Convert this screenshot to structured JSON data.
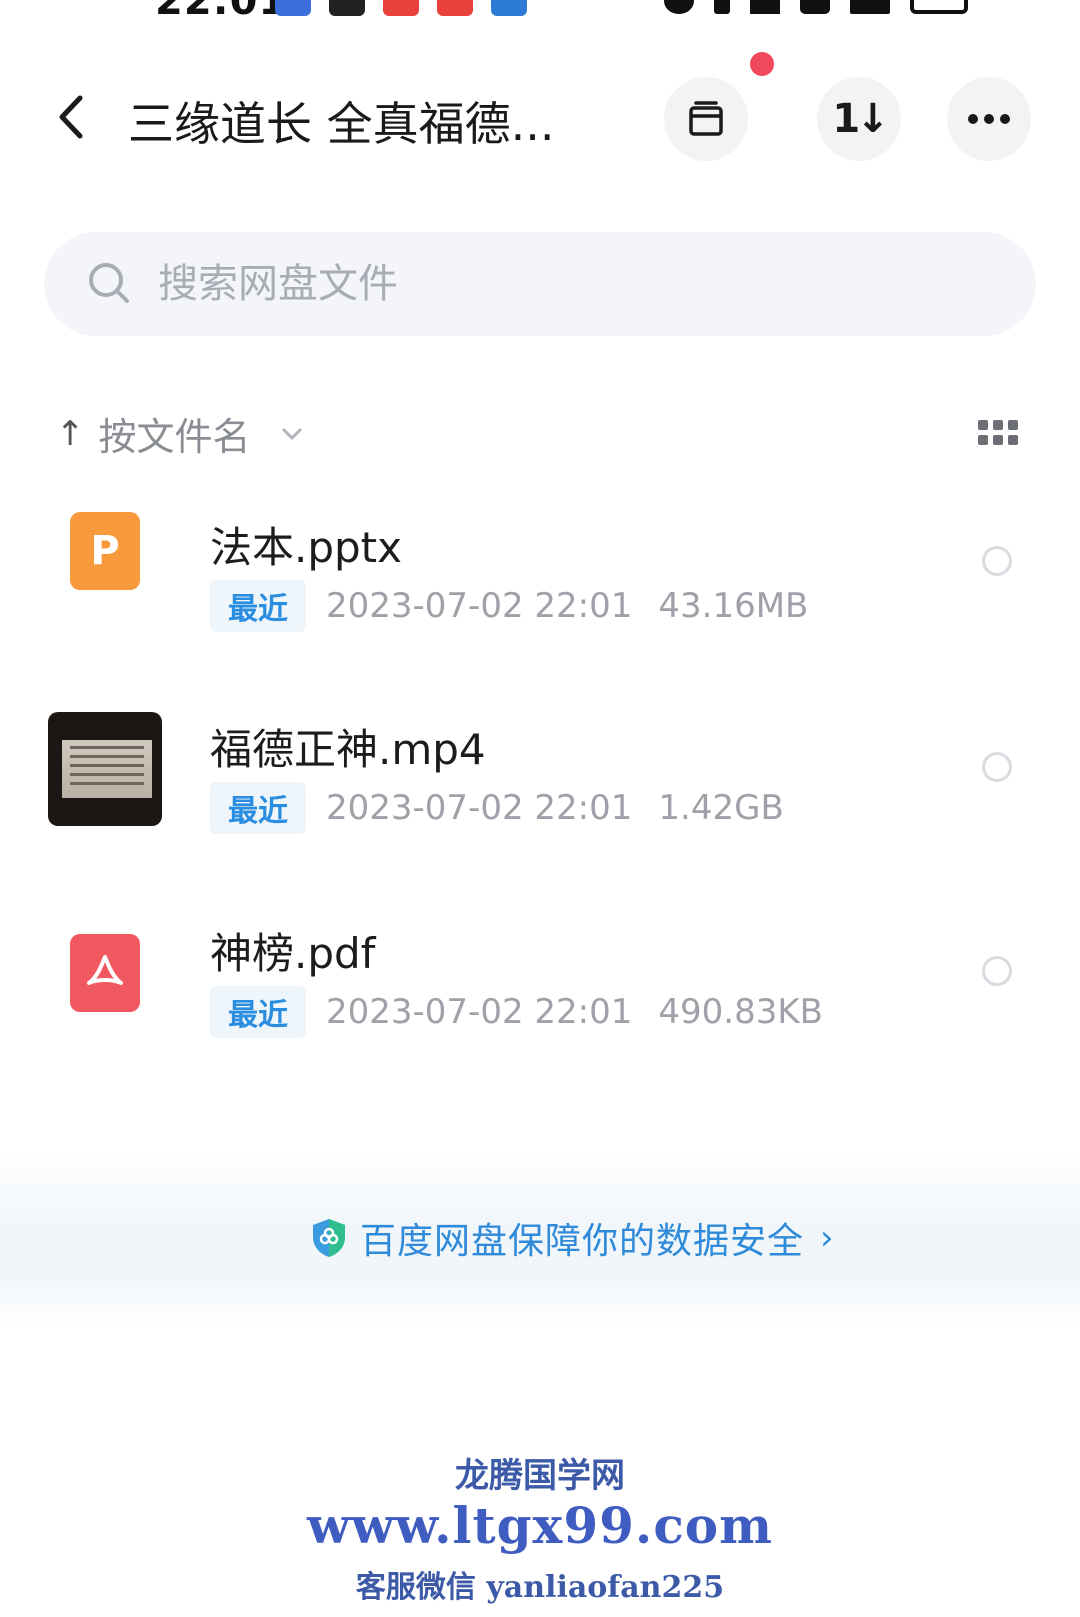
{
  "status_bar": {
    "time": "22:01",
    "app_icon_colors": [
      "#3b6ed8",
      "#222222",
      "#e8403a",
      "#e8403a",
      "#2e7bd6"
    ]
  },
  "header": {
    "title": "三缘道长 全真福德...",
    "transfer_label": "1↓",
    "notification_dot_color": "#f0485c"
  },
  "search": {
    "placeholder": "搜索网盘文件"
  },
  "sort": {
    "label": "按文件名"
  },
  "files": [
    {
      "name": "法本.pptx",
      "tag": "最近",
      "date": "2023-07-02 22:01",
      "size": "43.16MB",
      "icon": "ppt-file-icon",
      "icon_letter": "P",
      "color": "#f89a3c"
    },
    {
      "name": "福德正神.mp4",
      "tag": "最近",
      "date": "2023-07-02 22:01",
      "size": "1.42GB",
      "icon": "video-thumbnail"
    },
    {
      "name": "神榜.pdf",
      "tag": "最近",
      "date": "2023-07-02 22:01",
      "size": "490.83KB",
      "icon": "pdf-file-icon",
      "color": "#f0595f"
    }
  ],
  "security": {
    "text": "百度网盘保障你的数据安全",
    "color": "#2f8bd9"
  },
  "watermark": {
    "name": "龙腾国学网",
    "url": "www.ltgx99.com",
    "contact": "客服微信 yanliaofan225"
  }
}
